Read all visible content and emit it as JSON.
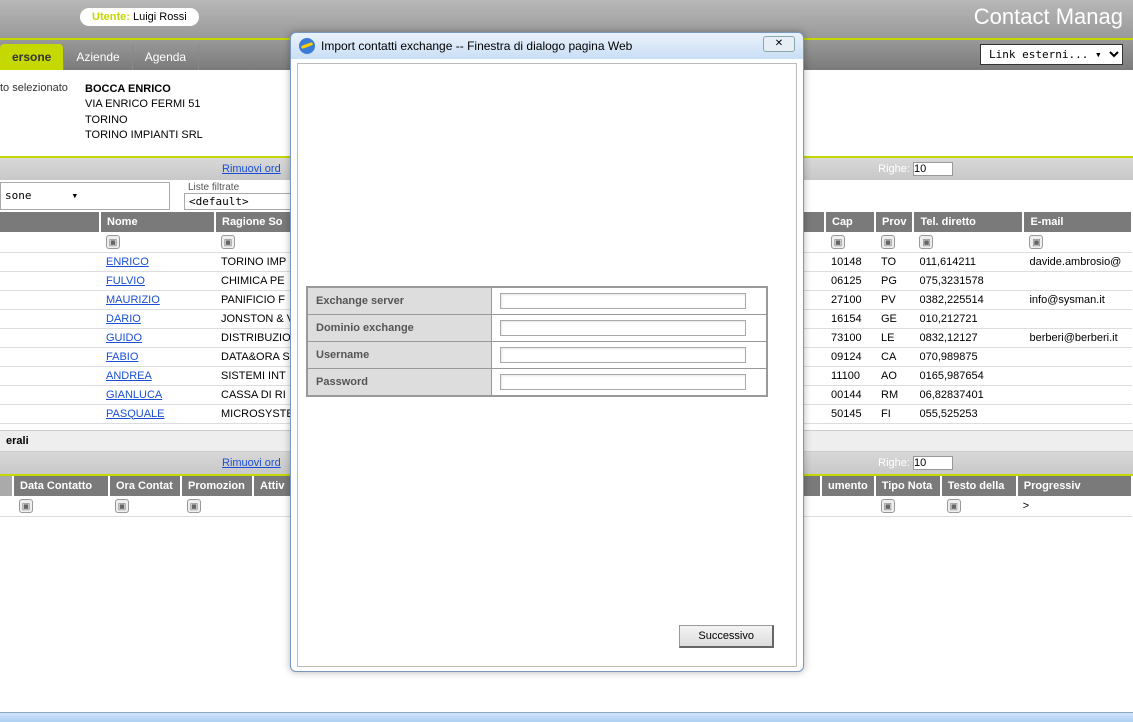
{
  "app_title": "Contact Manag",
  "user": {
    "label": "Utente:",
    "name": "Luigi Rossi"
  },
  "tabs": [
    {
      "label": "ersone",
      "active": true
    },
    {
      "label": "Aziende",
      "active": false
    },
    {
      "label": "Agenda",
      "active": false
    }
  ],
  "link_esterni": "Link esterni... ▾",
  "selected": {
    "label": "to selezionato",
    "name": "BOCCA   ENRICO",
    "addr1": "VIA ENRICO FERMI 51",
    "addr2": "TORINO",
    "company": "TORINO IMPIANTI SRL"
  },
  "strip": {
    "rimuovi": "Rimuovi ord",
    "righe_label": "Righe:",
    "righe_value": "10"
  },
  "filters": {
    "sel1": "sone",
    "liste_label": "Liste filtrate",
    "sel2": "<default>"
  },
  "grid": {
    "headers": [
      "",
      "Nome",
      "Ragione So",
      "Cap",
      "Prov",
      "Tel. diretto",
      "E-mail"
    ],
    "rows": [
      {
        "nome": "ENRICO",
        "rag": "TORINO IMP",
        "cap": "10148",
        "prov": "TO",
        "tel": "011,614211",
        "mail": "davide.ambrosio@"
      },
      {
        "nome": "FULVIO",
        "rag": "CHIMICA PE",
        "cap": "06125",
        "prov": "PG",
        "tel": "075,3231578",
        "mail": ""
      },
      {
        "nome": "MAURIZIO",
        "rag": "PANIFICIO F",
        "cap": "27100",
        "prov": "PV",
        "tel": "0382,225514",
        "mail": "info@sysman.it"
      },
      {
        "nome": "DARIO",
        "rag": "JONSTON & V",
        "cap": "16154",
        "prov": "GE",
        "tel": "010,212721",
        "mail": ""
      },
      {
        "nome": "GUIDO",
        "rag": "DISTRIBUZIO",
        "cap": "73100",
        "prov": "LE",
        "tel": "0832,12127",
        "mail": "berberi@berberi.it"
      },
      {
        "nome": "FABIO",
        "rag": "DATA&ORA S",
        "cap": "09124",
        "prov": "CA",
        "tel": "070,989875",
        "mail": ""
      },
      {
        "nome": "ANDREA",
        "rag": "SISTEMI INT",
        "cap": "11100",
        "prov": "AO",
        "tel": "0165,987654",
        "mail": ""
      },
      {
        "nome": "GIANLUCA",
        "rag": "CASSA DI RI",
        "cap": "00144",
        "prov": "RM",
        "tel": "06,82837401",
        "mail": ""
      },
      {
        "nome": "PASQUALE",
        "rag": "MICROSYSTE",
        "cap": "50145",
        "prov": "FI",
        "tel": "055,525253",
        "mail": ""
      }
    ]
  },
  "section2": {
    "title": "erali",
    "rimuovi": "Rimuovi ord",
    "righe_label": "Righe:",
    "righe_value": "10"
  },
  "notes_headers": [
    "Data Contatto",
    "Ora Contat",
    "Promozion",
    "Attiv",
    "umento",
    "Tipo Nota",
    "Testo della",
    "Progressiv"
  ],
  "notes_arrow": ">",
  "modal": {
    "title": "Import contatti exchange -- Finestra di dialogo pagina Web",
    "fields": [
      {
        "label": "Exchange server",
        "value": ""
      },
      {
        "label": "Dominio exchange",
        "value": ""
      },
      {
        "label": "Username",
        "value": ""
      },
      {
        "label": "Password",
        "value": ""
      }
    ],
    "next": "Successivo",
    "close": "✕"
  },
  "icons": {
    "filter": "▣"
  }
}
